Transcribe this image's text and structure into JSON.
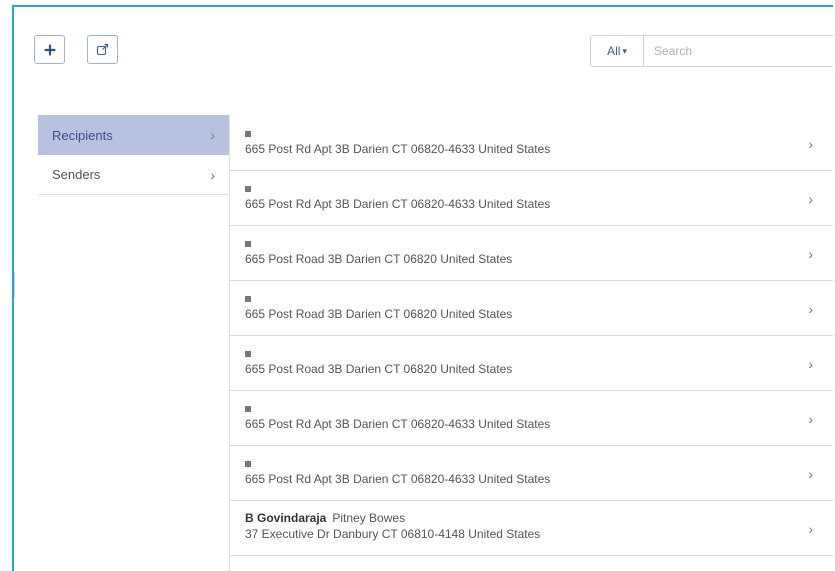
{
  "toolbar": {
    "add_icon": "plus-icon",
    "export_icon": "external-link-icon",
    "filter_label": "All",
    "search_placeholder": "Search"
  },
  "sidebar": {
    "items": [
      {
        "label": "Recipients",
        "active": true
      },
      {
        "label": "Senders",
        "active": false
      }
    ]
  },
  "addresses": [
    {
      "name": "",
      "company": "",
      "address": "665 Post Rd Apt 3B Darien CT 06820-4633 United States"
    },
    {
      "name": "",
      "company": "",
      "address": "665 Post Rd Apt 3B Darien CT 06820-4633 United States"
    },
    {
      "name": "",
      "company": "",
      "address": "665 Post Road 3B Darien CT 06820 United States"
    },
    {
      "name": "",
      "company": "",
      "address": "665 Post Road 3B Darien CT 06820 United States"
    },
    {
      "name": "",
      "company": "",
      "address": "665 Post Road 3B Darien CT 06820 United States"
    },
    {
      "name": "",
      "company": "",
      "address": "665 Post Rd Apt 3B Darien CT 06820-4633 United States"
    },
    {
      "name": "",
      "company": "",
      "address": "665 Post Rd Apt 3B Darien CT 06820-4633 United States"
    },
    {
      "name": "B Govindaraja",
      "company": "Pitney Bowes",
      "address": "37 Executive Dr Danbury CT 06810-4148 United States"
    }
  ],
  "colors": {
    "frame_border": "#2aa3dc",
    "active_item_bg": "#b6c2df",
    "accent_text": "#3d5a9a"
  }
}
